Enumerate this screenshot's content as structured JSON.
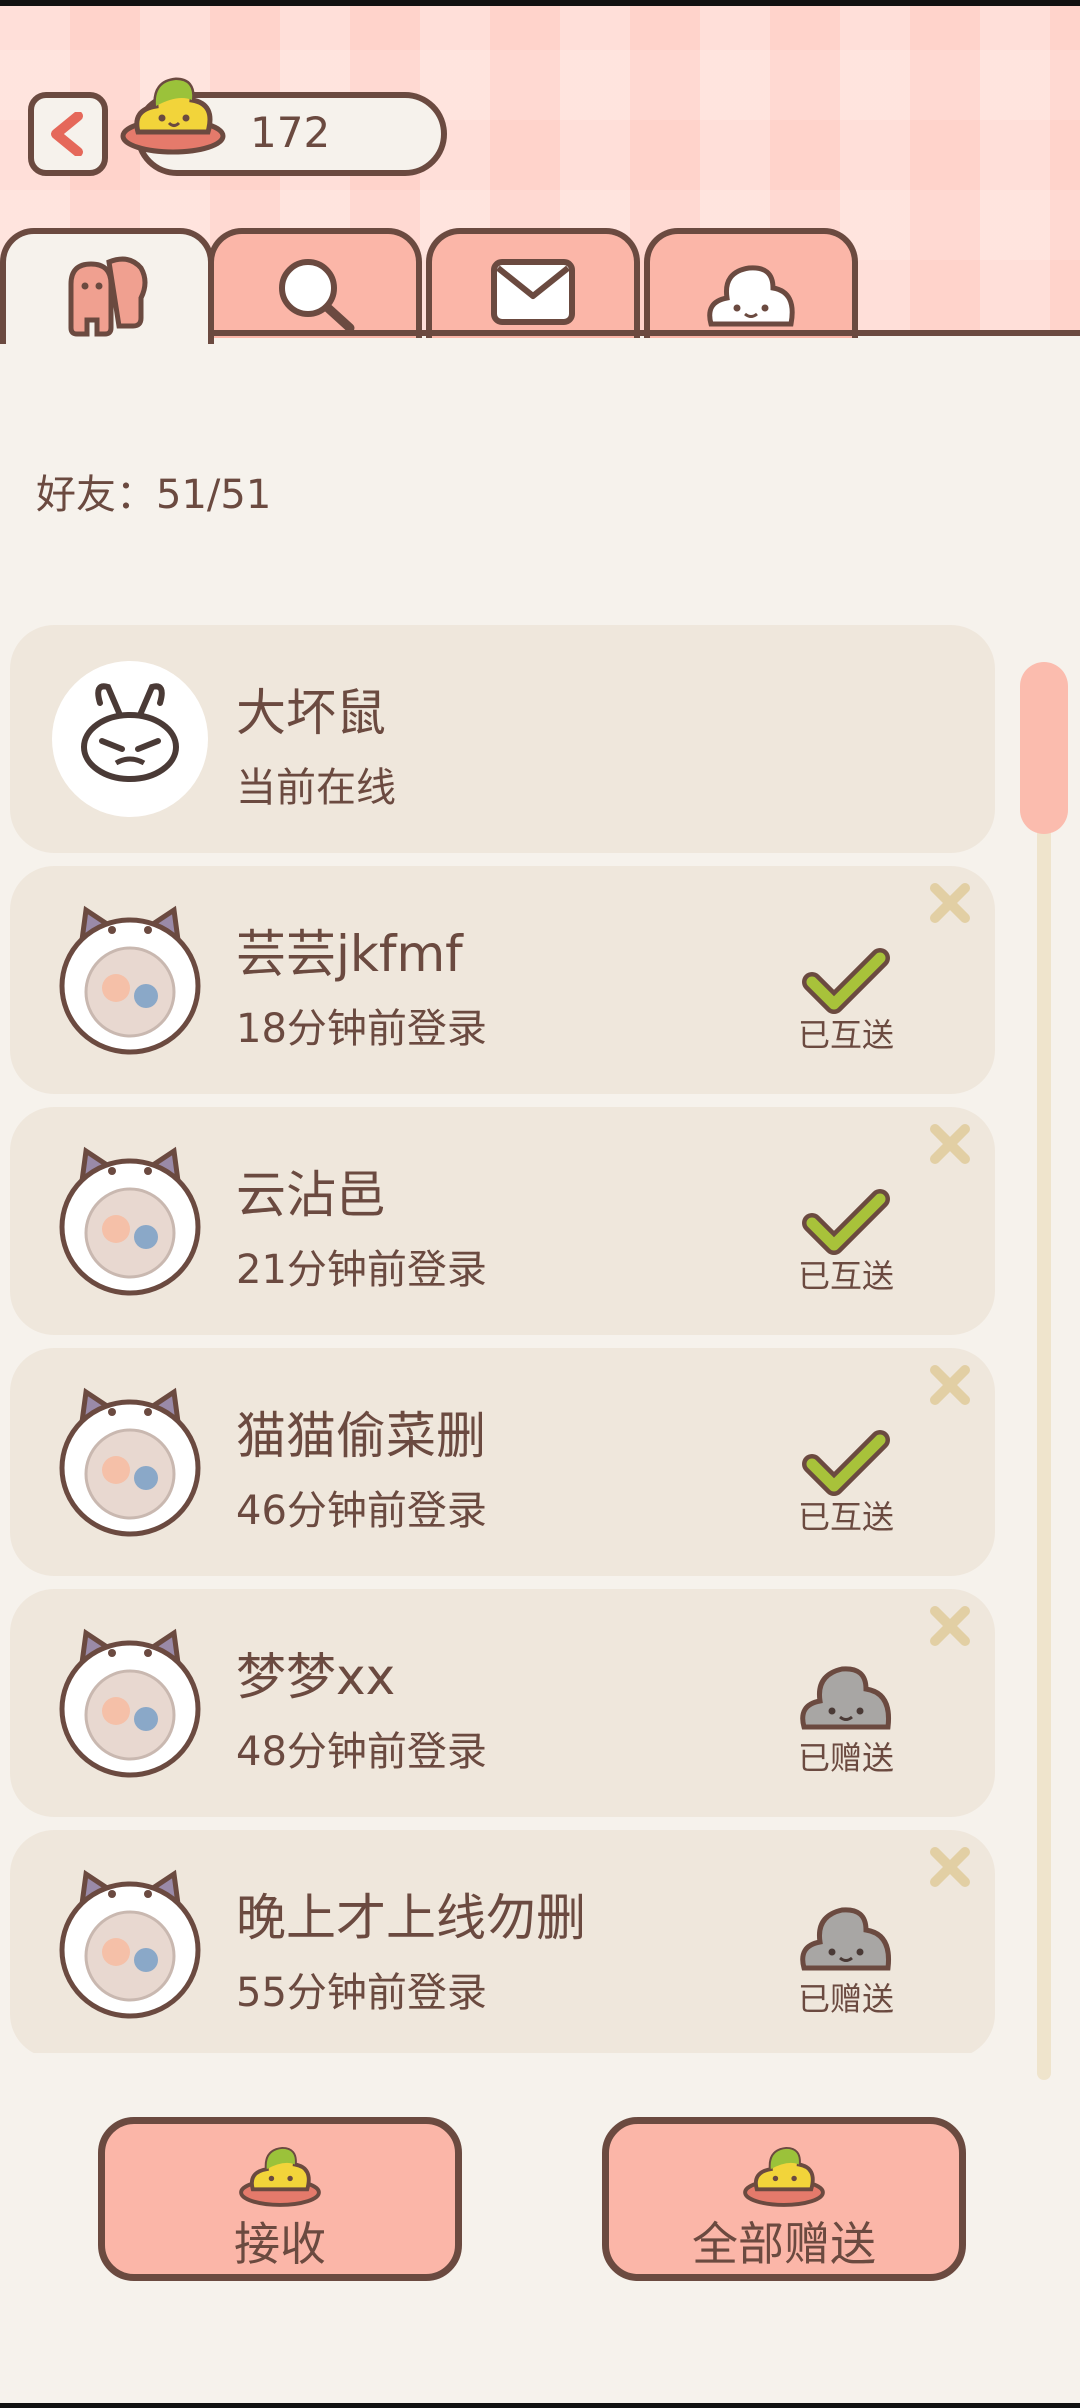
{
  "coins": {
    "value": "172"
  },
  "tabs": [
    {
      "id": "friends",
      "icon": "friends-icon",
      "active": true
    },
    {
      "id": "search",
      "icon": "search-icon",
      "active": false
    },
    {
      "id": "mail",
      "icon": "mail-icon",
      "active": false
    },
    {
      "id": "gift",
      "icon": "poop-icon",
      "active": false
    }
  ],
  "friend_count": "好友：51/51",
  "friends": [
    {
      "name": "大坏鼠",
      "status": "当前在线",
      "gift_label": "",
      "gift_state": "none",
      "removable": false
    },
    {
      "name": "芸芸jkfmf",
      "status": "18分钟前登录",
      "gift_label": "已互送",
      "gift_state": "mutual",
      "removable": true
    },
    {
      "name": "云沾邑",
      "status": "21分钟前登录",
      "gift_label": "已互送",
      "gift_state": "mutual",
      "removable": true
    },
    {
      "name": "猫猫偷菜删",
      "status": "46分钟前登录",
      "gift_label": "已互送",
      "gift_state": "mutual",
      "removable": true
    },
    {
      "name": "梦梦xx",
      "status": "48分钟前登录",
      "gift_label": "已赠送",
      "gift_state": "sent",
      "removable": true
    },
    {
      "name": "晚上才上线勿删",
      "status": "55分钟前登录",
      "gift_label": "已赠送",
      "gift_state": "sent",
      "removable": true
    }
  ],
  "buttons": {
    "receive": "接收",
    "send_all": "全部赠送"
  },
  "colors": {
    "accent": "#fbb6a8",
    "outline": "#6b4a40",
    "check": "#a8c23a",
    "background": "#f6f2ec"
  }
}
